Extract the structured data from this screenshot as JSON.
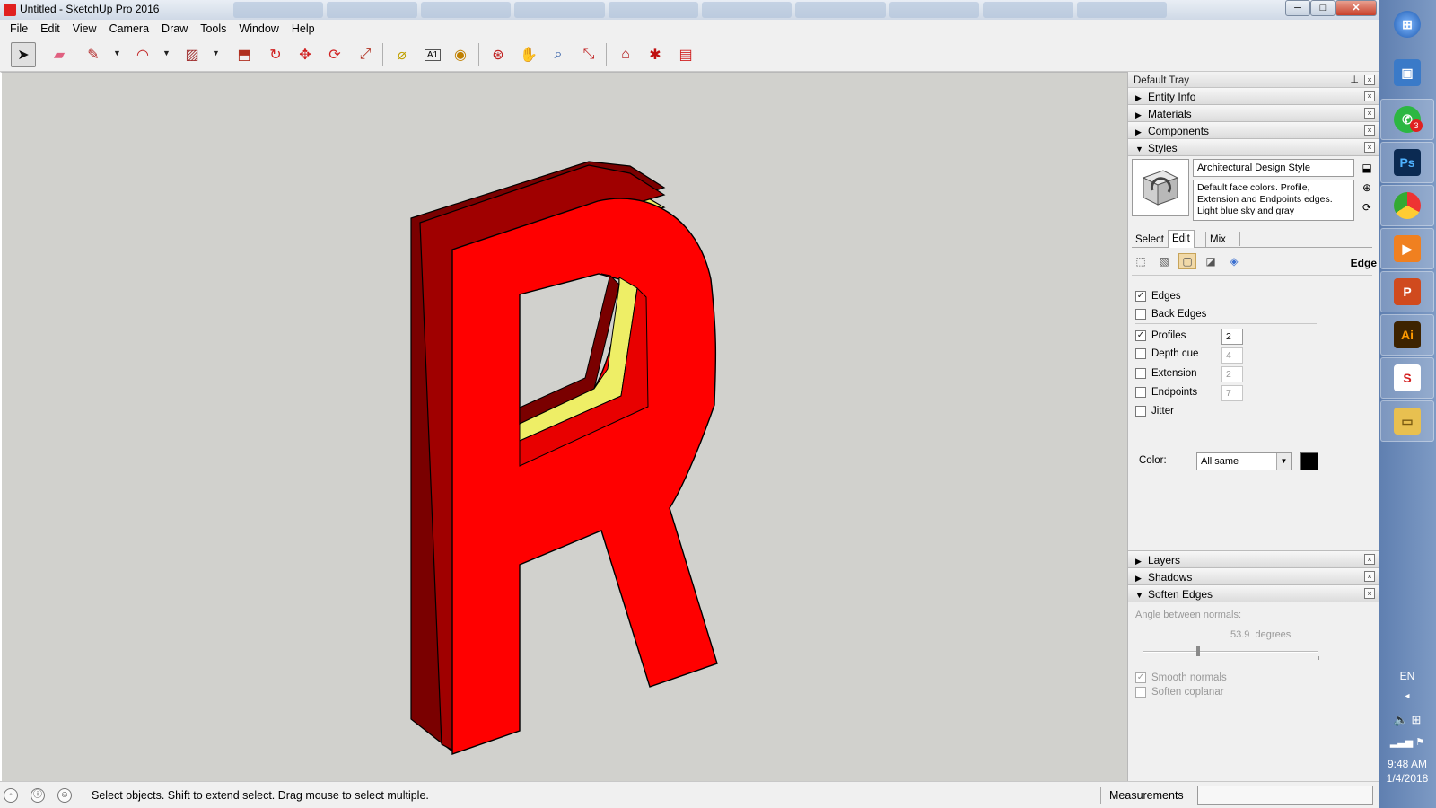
{
  "window": {
    "title": "Untitled - SketchUp Pro 2016",
    "controls": {
      "minimize": "─",
      "maximize": "□",
      "close": "✕"
    }
  },
  "menu": [
    "File",
    "Edit",
    "View",
    "Camera",
    "Draw",
    "Tools",
    "Window",
    "Help"
  ],
  "toolbar": {
    "tools": [
      {
        "name": "select-icon",
        "glyph": "➤"
      },
      {
        "name": "eraser-icon",
        "glyph": "▰"
      },
      {
        "name": "pencil-icon",
        "glyph": "✎"
      },
      {
        "name": "arc-icon",
        "glyph": "◠"
      },
      {
        "name": "rectangle-icon",
        "glyph": "▨"
      },
      {
        "name": "push-pull-icon",
        "glyph": "⬒"
      },
      {
        "name": "offset-icon",
        "glyph": "↻"
      },
      {
        "name": "move-icon",
        "glyph": "✥"
      },
      {
        "name": "rotate-icon",
        "glyph": "⟳"
      },
      {
        "name": "scale-icon",
        "glyph": "⤢"
      },
      {
        "name": "tape-measure-icon",
        "glyph": "⌀"
      },
      {
        "name": "text-icon",
        "glyph": "A1"
      },
      {
        "name": "paint-bucket-icon",
        "glyph": "◉"
      },
      {
        "name": "orbit-icon",
        "glyph": "⊛"
      },
      {
        "name": "pan-icon",
        "glyph": "✋"
      },
      {
        "name": "zoom-icon",
        "glyph": "⌕"
      },
      {
        "name": "zoom-extents-icon",
        "glyph": "⤡"
      },
      {
        "name": "3d-warehouse-icon",
        "glyph": "⌂"
      },
      {
        "name": "extension-warehouse-icon",
        "glyph": "✱"
      },
      {
        "name": "layout-icon",
        "glyph": "▤"
      }
    ]
  },
  "tray": {
    "title": "Default Tray",
    "pin": "⊥",
    "panels_top": [
      {
        "label": "Entity Info",
        "expanded": false
      },
      {
        "label": "Materials",
        "expanded": false
      },
      {
        "label": "Components",
        "expanded": false
      },
      {
        "label": "Styles",
        "expanded": true
      }
    ],
    "styles": {
      "name": "Architectural Design Style",
      "description": "Default face colors. Profile, Extension and Endpoints edges. Light blue sky and gray",
      "tabs": [
        "Select",
        "Edit",
        "Mix"
      ],
      "selected_tab": "Edit",
      "section_label": "Edge",
      "options": [
        {
          "label": "Edges",
          "checked": true
        },
        {
          "label": "Back Edges",
          "checked": false
        },
        {
          "label": "Profiles",
          "checked": true,
          "value": "2"
        },
        {
          "label": "Depth cue",
          "checked": false,
          "value": "4"
        },
        {
          "label": "Extension",
          "checked": false,
          "value": "2"
        },
        {
          "label": "Endpoints",
          "checked": false,
          "value": "7"
        },
        {
          "label": "Jitter",
          "checked": false
        }
      ],
      "color_label": "Color:",
      "color_value": "All same",
      "color_swatch": "#000000"
    },
    "panels_bottom": [
      {
        "label": "Layers",
        "expanded": false
      },
      {
        "label": "Shadows",
        "expanded": false
      },
      {
        "label": "Soften Edges",
        "expanded": true
      }
    ],
    "soften": {
      "label": "Angle between normals:",
      "value": "53.9",
      "unit": "degrees",
      "smooth_normals": "Smooth normals",
      "soften_coplanar": "Soften coplanar"
    }
  },
  "status": {
    "text": "Select objects. Shift to extend select. Drag mouse to select multiple.",
    "measurements_label": "Measurements"
  },
  "model": {
    "face_color": "#ff0000",
    "side_color": "#7a0000",
    "inner_color": "#eeee66"
  },
  "taskbar": {
    "apps": [
      {
        "name": "start-icon",
        "glyph": "⊞",
        "color": "#2f6fb5"
      },
      {
        "name": "computer-icon",
        "glyph": "▣",
        "color": "#3a7ac8"
      },
      {
        "name": "whatsapp-icon",
        "glyph": "✆",
        "color": "#2cb742",
        "badge": "3"
      },
      {
        "name": "photoshop-icon",
        "glyph": "Ps",
        "color": "#0b2a52"
      },
      {
        "name": "chrome-icon",
        "glyph": "◎",
        "color": "#e8b820"
      },
      {
        "name": "media-player-icon",
        "glyph": "▶",
        "color": "#f08020"
      },
      {
        "name": "powerpoint-icon",
        "glyph": "P",
        "color": "#d04a1e"
      },
      {
        "name": "illustrator-icon",
        "glyph": "Ai",
        "color": "#3d2300"
      },
      {
        "name": "sketchup-icon",
        "glyph": "S",
        "color": "#d42020"
      },
      {
        "name": "file-explorer-icon",
        "glyph": "▭",
        "color": "#e8c050"
      }
    ],
    "language": "EN",
    "time": "9:48 AM",
    "date": "1/4/2018"
  }
}
